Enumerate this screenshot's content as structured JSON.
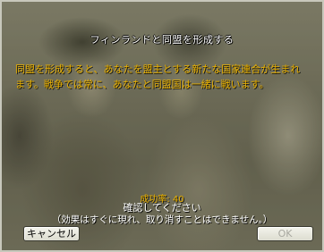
{
  "dialog": {
    "title": "フィンランドと同盟を形成する",
    "description": "同盟を形成すると、あなたを盟主とする新たな国家連合が生まれます。戦争では常に、あなたと同盟国は一緒に戦います。",
    "success_rate": "成功率: 40",
    "confirm_text": "確認してください",
    "note_text": "（効果はすぐに現れ、取り消すことはできません。）",
    "buttons": {
      "cancel_label": "キャンセル",
      "ok_label": "OK",
      "ok_enabled": false
    }
  },
  "colors": {
    "title": "#ffffff",
    "body_text": "#e8b000",
    "ok_disabled_text": "#a8a8a0"
  }
}
